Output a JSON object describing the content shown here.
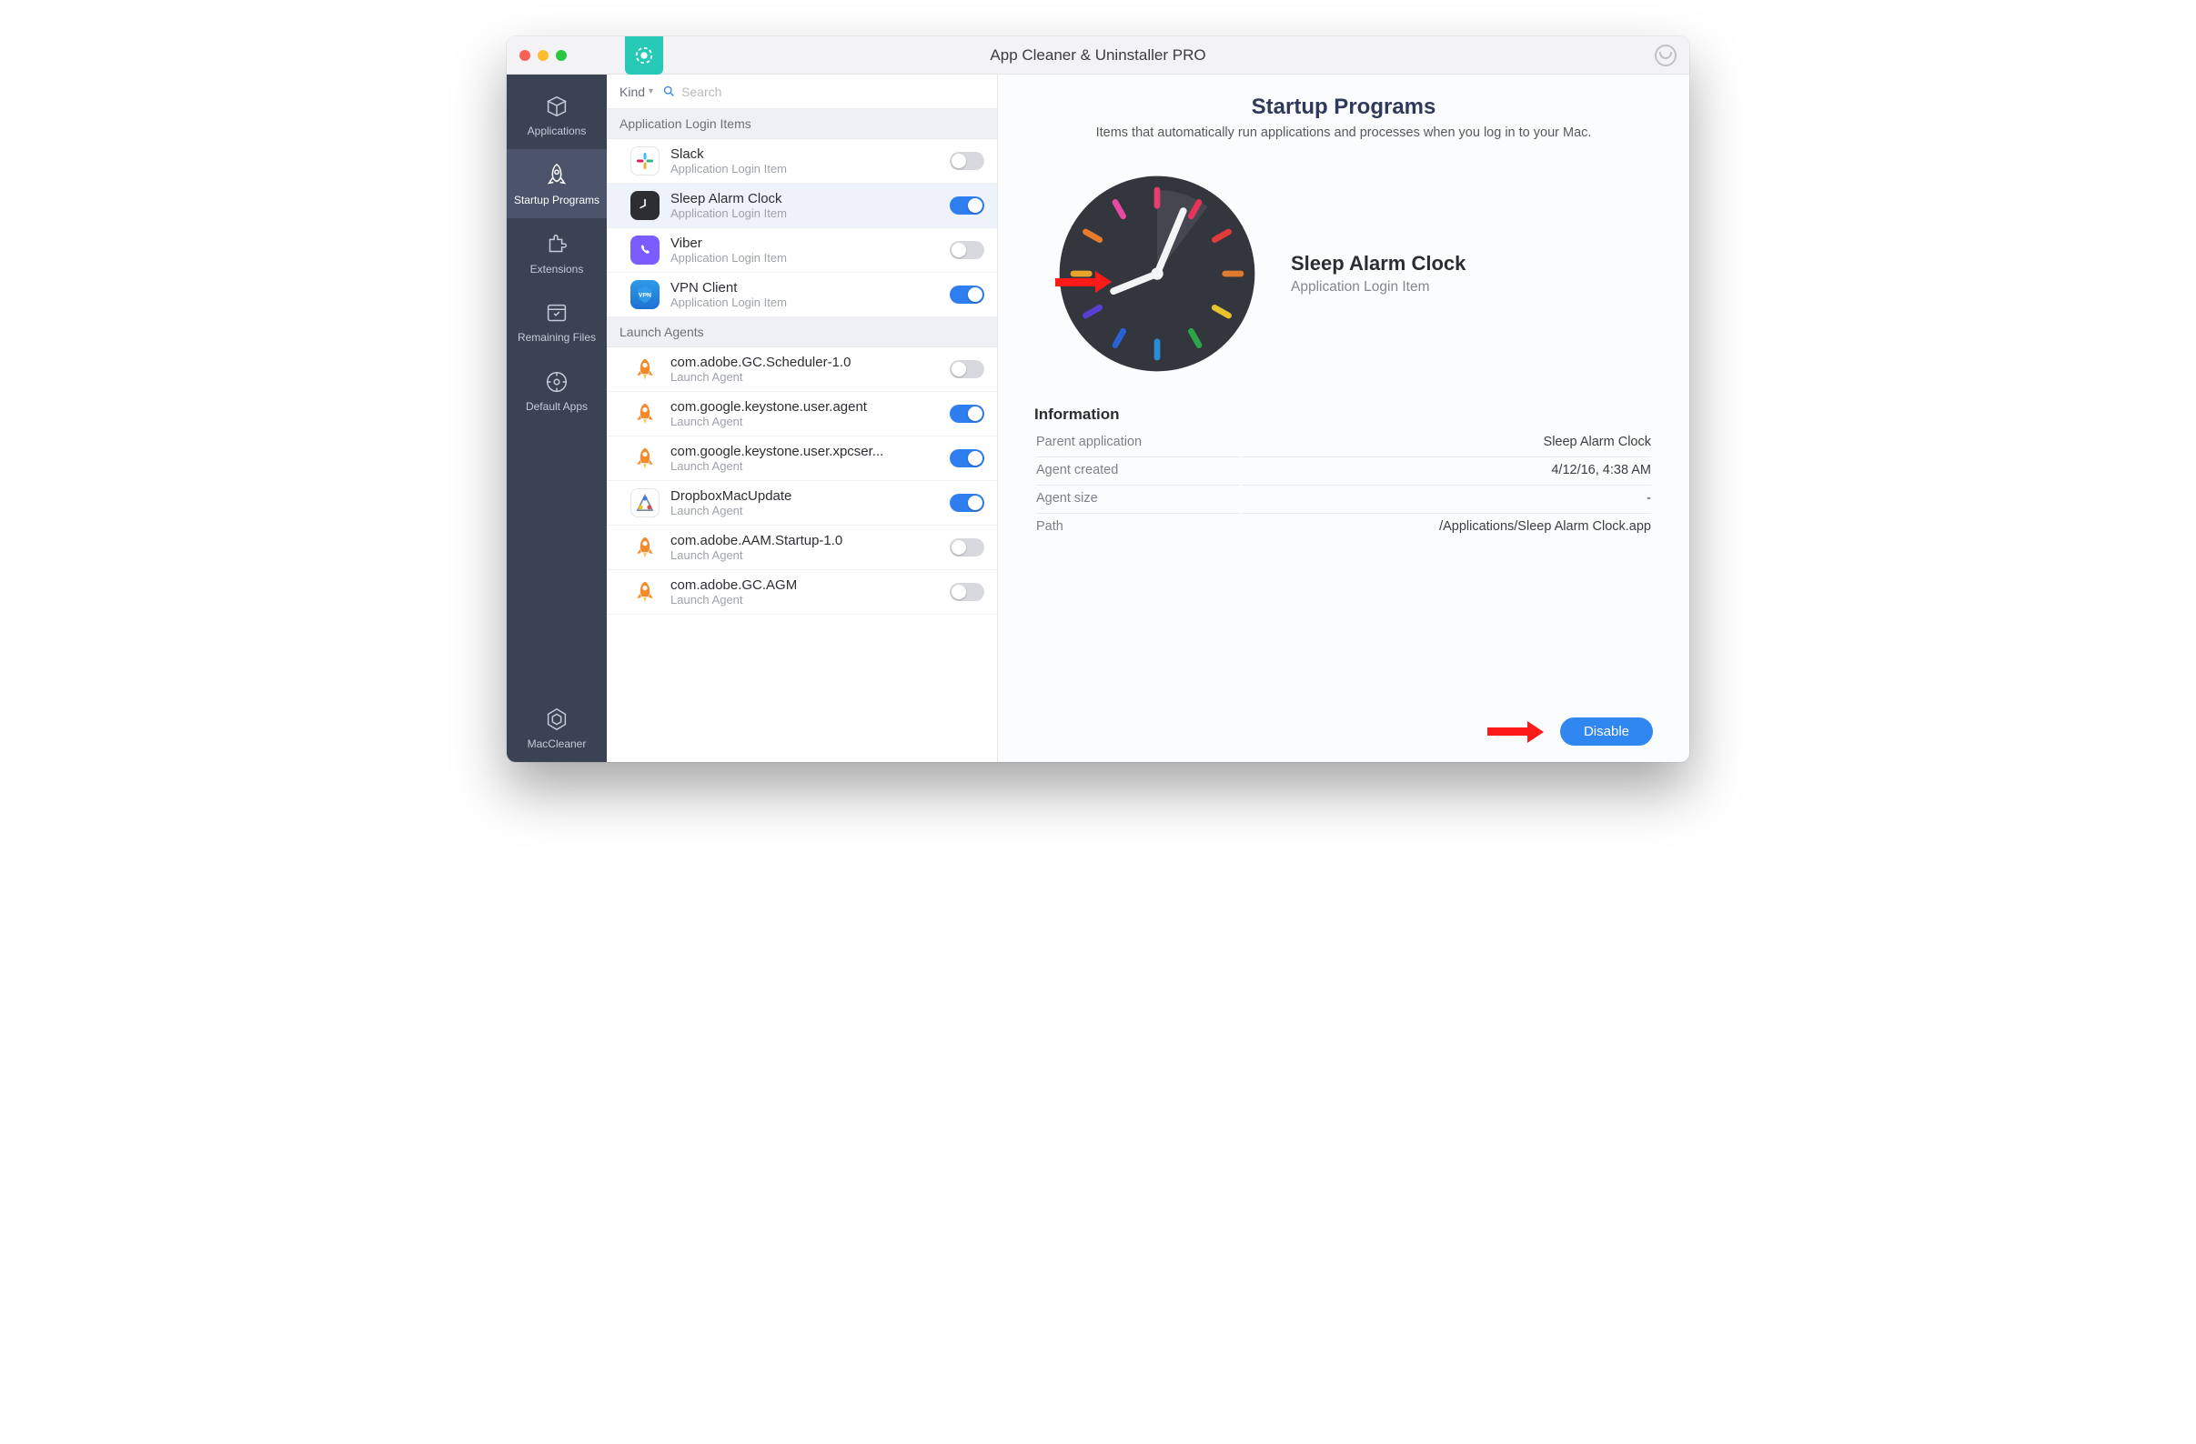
{
  "window": {
    "title": "App Cleaner & Uninstaller PRO"
  },
  "sidebar": {
    "items": [
      {
        "label": "Applications"
      },
      {
        "label": "Startup Programs"
      },
      {
        "label": "Extensions"
      },
      {
        "label": "Remaining Files"
      },
      {
        "label": "Default Apps"
      }
    ],
    "bottom": {
      "label": "MacCleaner"
    }
  },
  "toolbar": {
    "kind_label": "Kind",
    "search_placeholder": "Search"
  },
  "list": {
    "sections": [
      {
        "title": "Application Login Items",
        "items": [
          {
            "name": "Slack",
            "sub": "Application Login Item",
            "icon": "slack",
            "on": false
          },
          {
            "name": "Sleep Alarm Clock",
            "sub": "Application Login Item",
            "icon": "clock",
            "on": true,
            "selected": true
          },
          {
            "name": "Viber",
            "sub": "Application Login Item",
            "icon": "viber",
            "on": false
          },
          {
            "name": "VPN Client",
            "sub": "Application Login Item",
            "icon": "vpn",
            "on": true
          }
        ]
      },
      {
        "title": "Launch Agents",
        "items": [
          {
            "name": "com.adobe.GC.Scheduler-1.0",
            "sub": "Launch Agent",
            "icon": "rocket",
            "on": false
          },
          {
            "name": "com.google.keystone.user.agent",
            "sub": "Launch Agent",
            "icon": "rocket",
            "on": true
          },
          {
            "name": "com.google.keystone.user.xpcser...",
            "sub": "Launch Agent",
            "icon": "rocket",
            "on": true
          },
          {
            "name": "DropboxMacUpdate",
            "sub": "Launch Agent",
            "icon": "dropbox",
            "on": true
          },
          {
            "name": "com.adobe.AAM.Startup-1.0",
            "sub": "Launch Agent",
            "icon": "rocket",
            "on": false
          },
          {
            "name": "com.adobe.GC.AGM",
            "sub": "Launch Agent",
            "icon": "rocket",
            "on": false
          }
        ]
      }
    ]
  },
  "detail": {
    "heading": "Startup Programs",
    "subtitle": "Items that automatically run applications and processes when you log in to your Mac.",
    "app_name": "Sleep Alarm Clock",
    "app_kind": "Application Login Item",
    "info_heading": "Information",
    "info": [
      {
        "k": "Parent application",
        "v": "Sleep Alarm Clock"
      },
      {
        "k": "Agent created",
        "v": "4/12/16, 4:38 AM"
      },
      {
        "k": "Agent size",
        "v": "-"
      },
      {
        "k": "Path",
        "v": "/Applications/Sleep Alarm Clock.app"
      }
    ],
    "action_label": "Disable"
  }
}
